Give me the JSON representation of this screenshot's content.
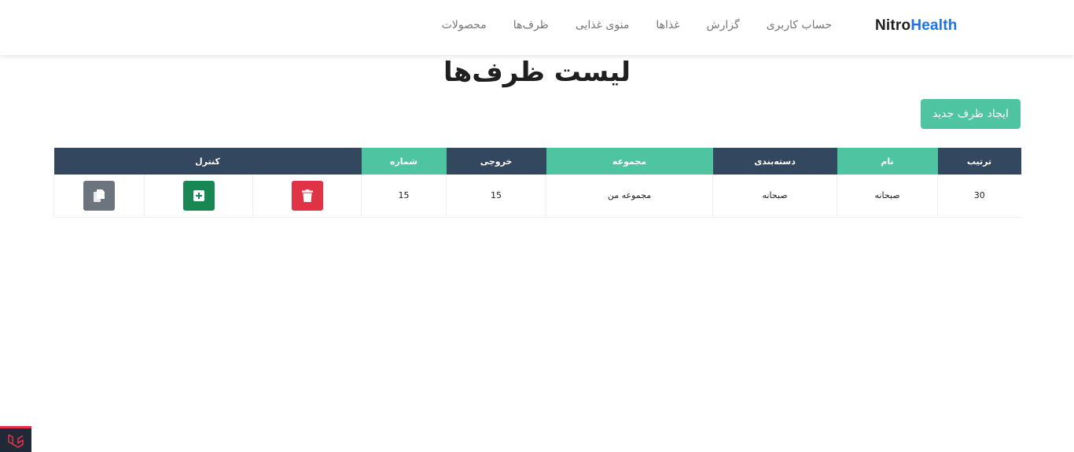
{
  "brand": {
    "part1": "Nitro",
    "part2": "Health"
  },
  "nav": {
    "items": [
      "محصولات",
      "ظرف‌ها",
      "منوی غذایی",
      "غذاها",
      "گزارش",
      "حساب کاربری"
    ]
  },
  "page": {
    "title": "لیست ظرف‌ها",
    "create_button": "ایجاد ظرف جدید"
  },
  "table": {
    "headers": [
      "ترتیب",
      "نام",
      "دسته‌بندی",
      "مجموعه",
      "خروجی",
      "شماره",
      "کنترل"
    ],
    "rows": [
      {
        "order": "30",
        "name": "صبحانه",
        "category": "صبحانه",
        "collection": "مجموعه من",
        "output": "15",
        "number": "15"
      }
    ]
  },
  "icons": {
    "delete": "trash-icon",
    "add": "plus-square-icon",
    "copy": "copy-icon",
    "corner": "laravel-logo-icon"
  },
  "colors": {
    "accent_green": "#4fc4a0",
    "header_dark": "#33475f",
    "danger": "#e03345",
    "success": "#198754",
    "secondary": "#6c757d",
    "brand_blue": "#1a73e8"
  }
}
